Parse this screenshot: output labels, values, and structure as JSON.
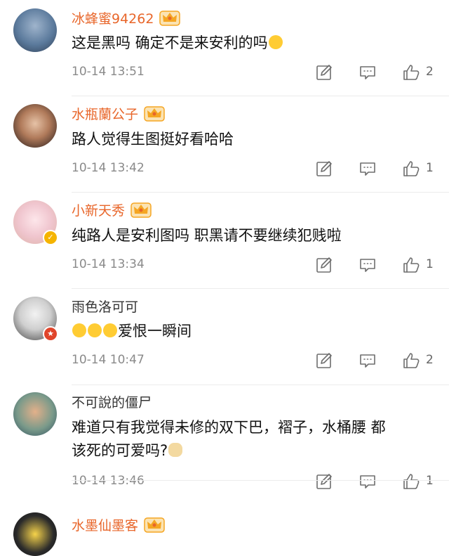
{
  "comments": [
    {
      "username": "冰蜂蜜94262",
      "vip": true,
      "text_lines": [
        "这是黑吗 确定不是来安利的吗"
      ],
      "trailing_emoji": "laugh-cry",
      "leading_emoji_count": 0,
      "time": "10-14 13:51",
      "likes": "2"
    },
    {
      "username": "水瓶蘭公子",
      "vip": true,
      "text_lines": [
        "路人觉得生图挺好看哈哈"
      ],
      "trailing_emoji": "",
      "leading_emoji_count": 0,
      "time": "10-14 13:42",
      "likes": "1"
    },
    {
      "username": "小新天秀",
      "vip": true,
      "text_lines": [
        "纯路人是安利图吗 职黑请不要继续犯贱啦"
      ],
      "trailing_emoji": "",
      "leading_emoji_count": 0,
      "time": "10-14 13:34",
      "likes": "1"
    },
    {
      "username": "雨色洛可可",
      "vip": false,
      "text_lines": [
        "爱恨一瞬间"
      ],
      "trailing_emoji": "",
      "leading_emoji_count": 3,
      "time": "10-14 10:47",
      "likes": "2"
    },
    {
      "username": "不可說的僵尸",
      "vip": false,
      "text_lines": [
        "难道只有我觉得未修的双下巴，褶子，水桶腰 都",
        "该死的可爱吗?"
      ],
      "trailing_emoji": "doge",
      "leading_emoji_count": 0,
      "time": "10-14 13:46",
      "likes": "1"
    },
    {
      "username": "水墨仙墨客",
      "vip": true,
      "text_lines": [],
      "trailing_emoji": "",
      "leading_emoji_count": 0,
      "time": "",
      "likes": ""
    }
  ],
  "colors": {
    "vip_name": "#e8662a",
    "plain_name": "#333333",
    "time": "#8a8a8a",
    "crown": "#f5a623",
    "icon_stroke": "#6e6e6e"
  },
  "icons": {
    "edit": "edit-icon",
    "reply": "comment-icon",
    "like": "thumbs-up-icon",
    "crown": "vip-crown-icon"
  }
}
